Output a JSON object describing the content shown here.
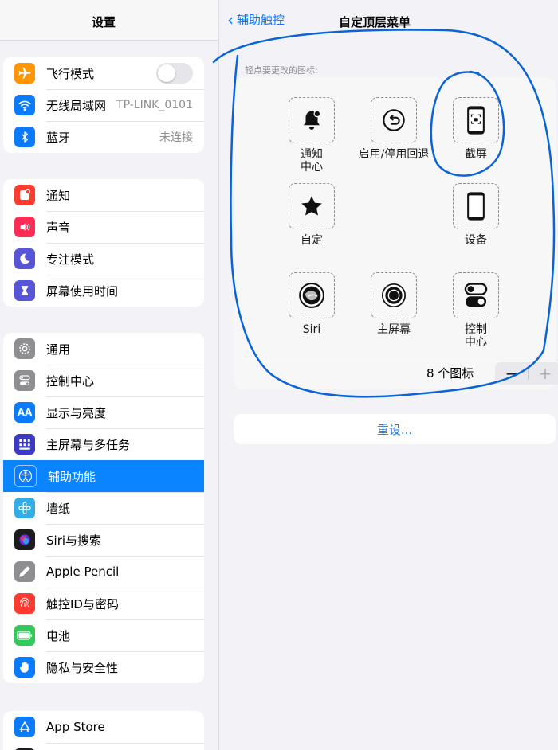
{
  "sidebar": {
    "title": "设置",
    "groups": [
      {
        "items": [
          {
            "label": "飞行模式",
            "icon": "airplane-icon",
            "color": "#ff9500",
            "toggle": false
          },
          {
            "label": "无线局域网",
            "icon": "wifi-icon",
            "color": "#0a7aff",
            "value": "TP-LINK_0101"
          },
          {
            "label": "蓝牙",
            "icon": "bluetooth-icon",
            "color": "#0a7aff",
            "value": "未连接"
          }
        ]
      },
      {
        "items": [
          {
            "label": "通知",
            "icon": "notification-icon",
            "color": "#ff3b30"
          },
          {
            "label": "声音",
            "icon": "sound-icon",
            "color": "#ff2d55"
          },
          {
            "label": "专注模式",
            "icon": "moon-icon",
            "color": "#5856d6"
          },
          {
            "label": "屏幕使用时间",
            "icon": "hourglass-icon",
            "color": "#5856d6"
          }
        ]
      },
      {
        "items": [
          {
            "label": "通用",
            "icon": "gear-icon",
            "color": "#8e8e93"
          },
          {
            "label": "控制中心",
            "icon": "control-center-icon",
            "color": "#8e8e93"
          },
          {
            "label": "显示与亮度",
            "icon": "display-icon",
            "color": "#0a7aff"
          },
          {
            "label": "主屏幕与多任务",
            "icon": "home-grid-icon",
            "color": "#3a3ac6"
          },
          {
            "label": "辅助功能",
            "icon": "accessibility-icon",
            "color": "#0a7aff",
            "selected": true
          },
          {
            "label": "墙纸",
            "icon": "wallpaper-icon",
            "color": "#32ade6"
          },
          {
            "label": "Siri与搜索",
            "icon": "siri-icon",
            "color": "#1c1c1e"
          },
          {
            "label": "Apple Pencil",
            "icon": "pencil-icon",
            "color": "#8e8e93"
          },
          {
            "label": "触控ID与密码",
            "icon": "fingerprint-icon",
            "color": "#ff3b30"
          },
          {
            "label": "电池",
            "icon": "battery-icon",
            "color": "#34c759"
          },
          {
            "label": "隐私与安全性",
            "icon": "hand-icon",
            "color": "#0a7aff"
          }
        ]
      },
      {
        "items": [
          {
            "label": "App Store",
            "icon": "app-store-icon",
            "color": "#0a7aff"
          }
        ]
      }
    ]
  },
  "nav": {
    "back_label": "辅助触控",
    "title": "自定顶层菜单"
  },
  "menu": {
    "caption": "轻点要更改的图标:",
    "slots": [
      {
        "label": "通知\n中心",
        "icon": "notification-center-icon"
      },
      {
        "label": "启用/停用回退",
        "icon": "undo-icon"
      },
      {
        "label": "截屏",
        "icon": "screenshot-icon"
      },
      {
        "label": "自定",
        "icon": "star-icon"
      },
      {
        "label": "设备",
        "icon": "device-icon"
      },
      {
        "label": "Siri",
        "icon": "siri-icon"
      },
      {
        "label": "主屏幕",
        "icon": "home-button-icon"
      },
      {
        "label": "控制\n中心",
        "icon": "control-center-icon"
      }
    ],
    "count_label": "8 个图标",
    "minus": "−",
    "plus": "+"
  },
  "reset_label": "重设...",
  "colors": {
    "accent": "#0a7aff",
    "annotation": "#0a64d6"
  }
}
